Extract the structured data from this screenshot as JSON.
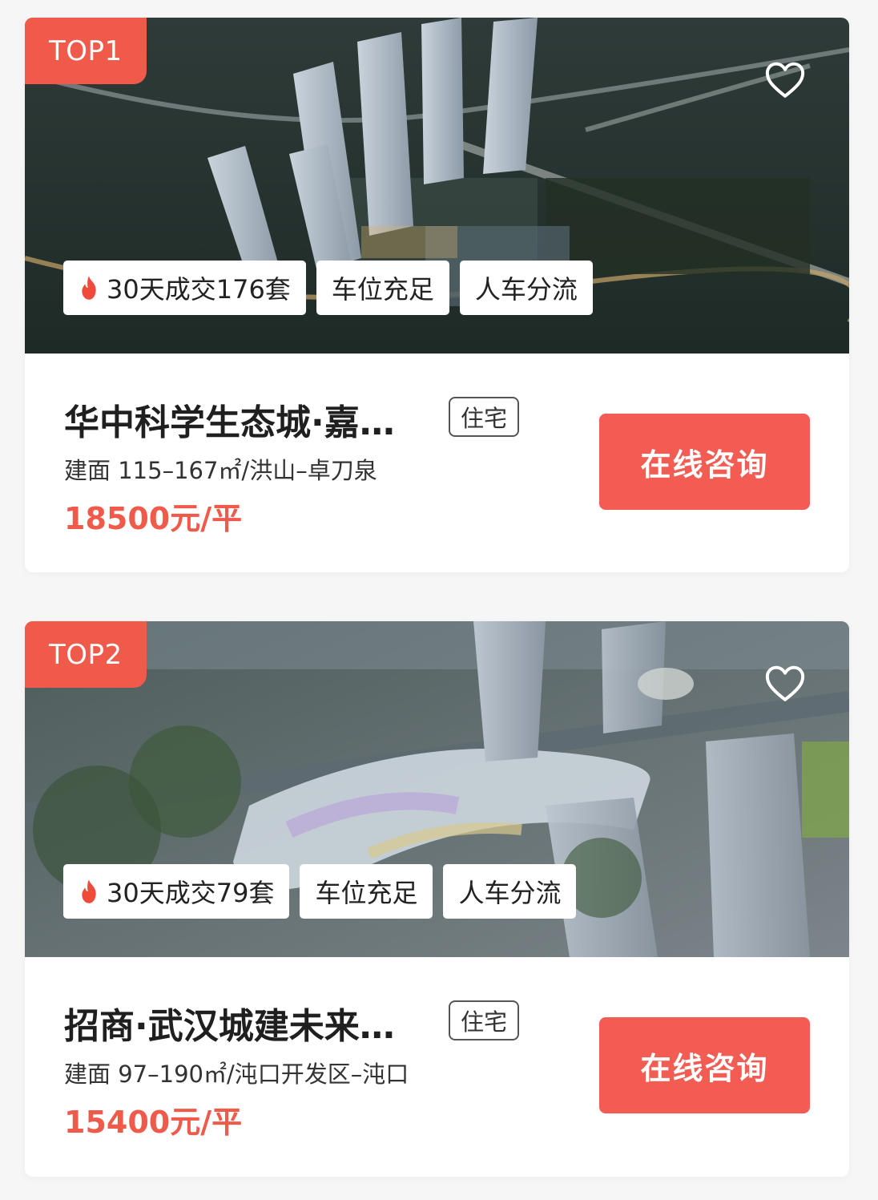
{
  "listings": [
    {
      "rank": "TOP1",
      "favorite_icon": "heart-outline-icon",
      "tags": [
        {
          "icon": "flame-icon",
          "label": "30天成交176套"
        },
        {
          "label": "车位充足"
        },
        {
          "label": "人车分流"
        }
      ],
      "name": "华中科学生态城·嘉…",
      "type": "住宅",
      "spec": "建面 115–167㎡/洪山–卓刀泉",
      "price": "18500元/平",
      "consult_label": "在线咨询"
    },
    {
      "rank": "TOP2",
      "favorite_icon": "heart-outline-icon",
      "tags": [
        {
          "icon": "flame-icon",
          "label": "30天成交79套"
        },
        {
          "label": "车位充足"
        },
        {
          "label": "人车分流"
        }
      ],
      "name": "招商·武汉城建未来…",
      "type": "住宅",
      "spec": "建面 97–190㎡/沌口开发区–沌口",
      "price": "15400元/平",
      "consult_label": "在线咨询"
    }
  ],
  "colors": {
    "accent": "#ef5a4a",
    "button": "#f25c52",
    "page_bg": "#f6f6f7",
    "card_bg": "#ffffff"
  }
}
